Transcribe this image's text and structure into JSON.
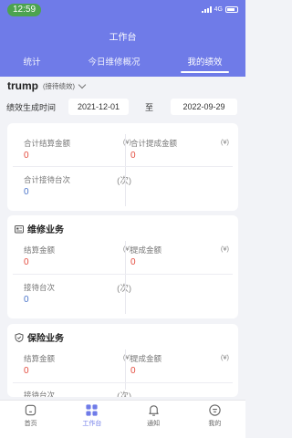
{
  "status_bar": {
    "time": "12:59",
    "network": "4G"
  },
  "header": {
    "title": "工作台"
  },
  "tabs": [
    {
      "label": "统计"
    },
    {
      "label": "今日维修概况"
    },
    {
      "label": "我的绩效"
    }
  ],
  "user": {
    "name": "trump",
    "role": "(接待绩效)"
  },
  "date_filter": {
    "label": "绩效生成时间",
    "from": "2021-12-01",
    "separator": "至",
    "to": "2022-09-29"
  },
  "summary": {
    "settle_total": {
      "label": "合计结算金额",
      "unit": "(¥)",
      "value": "0"
    },
    "commission_total": {
      "label": "合计提成金额",
      "unit": "(¥)",
      "value": "0"
    },
    "reception_total": {
      "label": "合计接待台次",
      "unit": "(次)",
      "value": "0"
    }
  },
  "repair": {
    "title": "维修业务",
    "settle": {
      "label": "结算金额",
      "unit": "(¥)",
      "value": "0"
    },
    "commission": {
      "label": "提成金额",
      "unit": "(¥)",
      "value": "0"
    },
    "reception": {
      "label": "接待台次",
      "unit": "(次)",
      "value": "0"
    }
  },
  "insurance": {
    "title": "保险业务",
    "settle": {
      "label": "结算金额",
      "unit": "(¥)",
      "value": "0"
    },
    "commission": {
      "label": "提成金额",
      "unit": "(¥)",
      "value": "0"
    },
    "reception": {
      "label": "接待台次",
      "unit": "(次)",
      "value": ""
    }
  },
  "bottom_nav": [
    {
      "label": "首页",
      "icon": "home-icon"
    },
    {
      "label": "工作台",
      "icon": "grid-icon"
    },
    {
      "label": "通知",
      "icon": "bell-icon"
    },
    {
      "label": "我的",
      "icon": "profile-icon"
    }
  ],
  "colors": {
    "primary": "#6f7be8",
    "value_red": "#e44b3e",
    "value_blue": "#4a74c9",
    "status_green": "#4ca34f"
  }
}
